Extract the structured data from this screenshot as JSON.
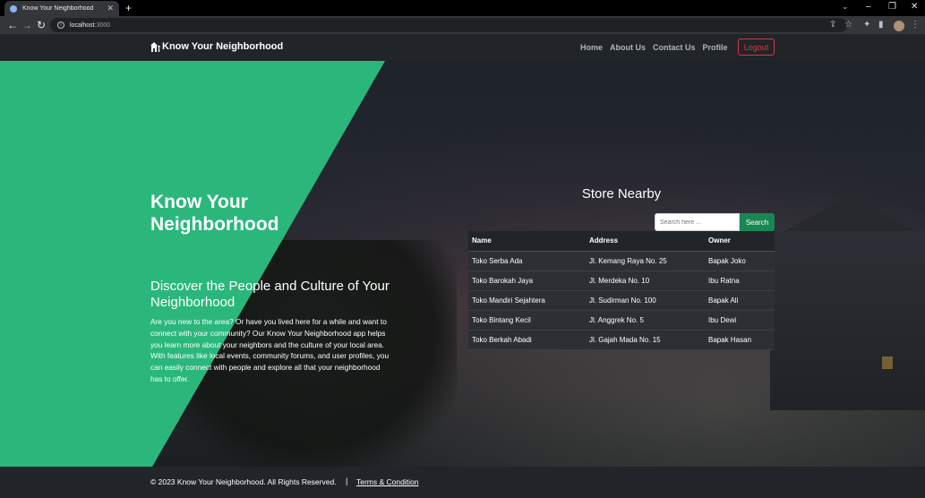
{
  "browser": {
    "tab_title": "Know Your Neighborhood",
    "tab_close": "✕",
    "new_tab": "+",
    "url_host": "localhost",
    "url_port": ":3000"
  },
  "navbar": {
    "brand": "Know Your Neighborhood",
    "links": [
      "Home",
      "About Us",
      "Contact Us",
      "Profile"
    ],
    "logout": "Logout"
  },
  "hero": {
    "title": "Know Your Neighborhood",
    "subtitle": "Discover the People and Culture of Your Neighborhood",
    "description": "Are you new to the area? Or have you lived here for a while and want to connect with your community? Our Know Your Neighborhood app helps you learn more about your neighbors and the culture of your local area. With features like local events, community forums, and user profiles, you can easily connect with people and explore all that your neighborhood has to offer."
  },
  "stores": {
    "title": "Store Nearby",
    "search_placeholder": "Search here ...",
    "search_button": "Search",
    "columns": [
      "Name",
      "Address",
      "Owner"
    ],
    "rows": [
      [
        "Toko Serba Ada",
        "Jl. Kemang Raya No. 25",
        "Bapak Joko"
      ],
      [
        "Toko Barokah Jaya",
        "Jl. Merdeka No. 10",
        "Ibu Ratna"
      ],
      [
        "Toko Mandiri Sejahtera",
        "Jl. Sudirman No. 100",
        "Bapak Ali"
      ],
      [
        "Toko Bintang Kecil",
        "Jl. Anggrek No. 5",
        "Ibu Dewi"
      ],
      [
        "Toko Berkah Abadi",
        "Jl. Gajah Mada No. 15",
        "Bapak Hasan"
      ]
    ]
  },
  "footer": {
    "copyright": "© 2023 Know Your Neighborhood. All Rights Reserved.",
    "separator": "|",
    "terms": "Terms & Condition"
  },
  "colors": {
    "accent_green": "#2bb77c",
    "search_green": "#198754",
    "logout_red": "#dc3545",
    "navbar_bg": "#212529"
  }
}
